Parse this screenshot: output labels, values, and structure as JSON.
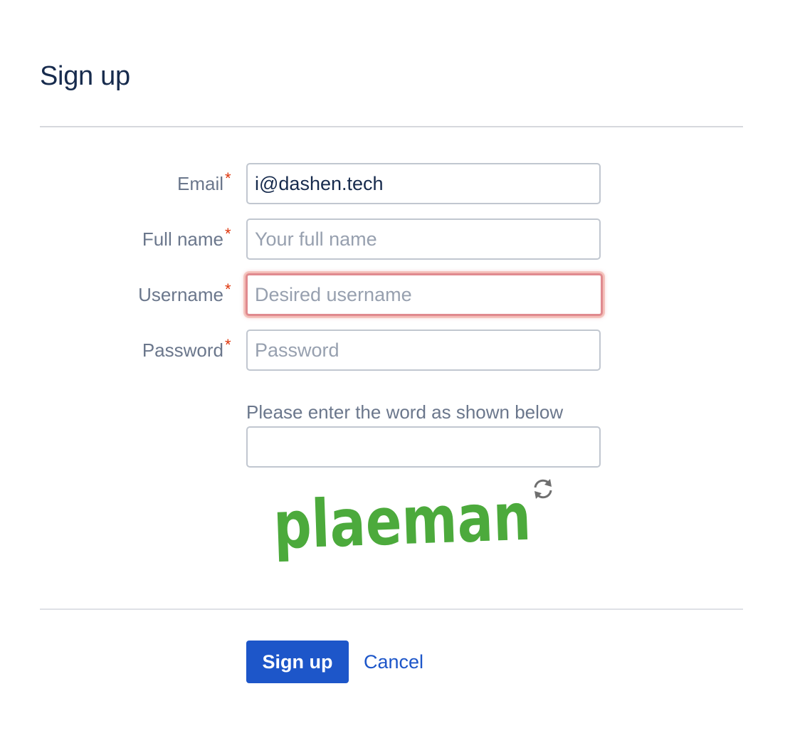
{
  "page": {
    "title": "Sign up"
  },
  "form": {
    "required_marker": "*",
    "email": {
      "label": "Email",
      "value": "i@dashen.tech",
      "placeholder": ""
    },
    "full_name": {
      "label": "Full name",
      "value": "",
      "placeholder": "Your full name"
    },
    "username": {
      "label": "Username",
      "value": "",
      "placeholder": "Desired username",
      "state": "focused-error"
    },
    "password": {
      "label": "Password",
      "value": "",
      "placeholder": "Password"
    },
    "captcha": {
      "prompt": "Please enter the word as shown below",
      "value": "",
      "word": "plaeman",
      "refresh_icon": "refresh-icon"
    }
  },
  "actions": {
    "submit_label": "Sign up",
    "cancel_label": "Cancel"
  },
  "colors": {
    "title": "#172b4d",
    "label": "#6b778c",
    "required": "#de350b",
    "primary": "#1d56c9",
    "error_focus": "#e08a8f",
    "captcha_text": "#4caa3c"
  }
}
